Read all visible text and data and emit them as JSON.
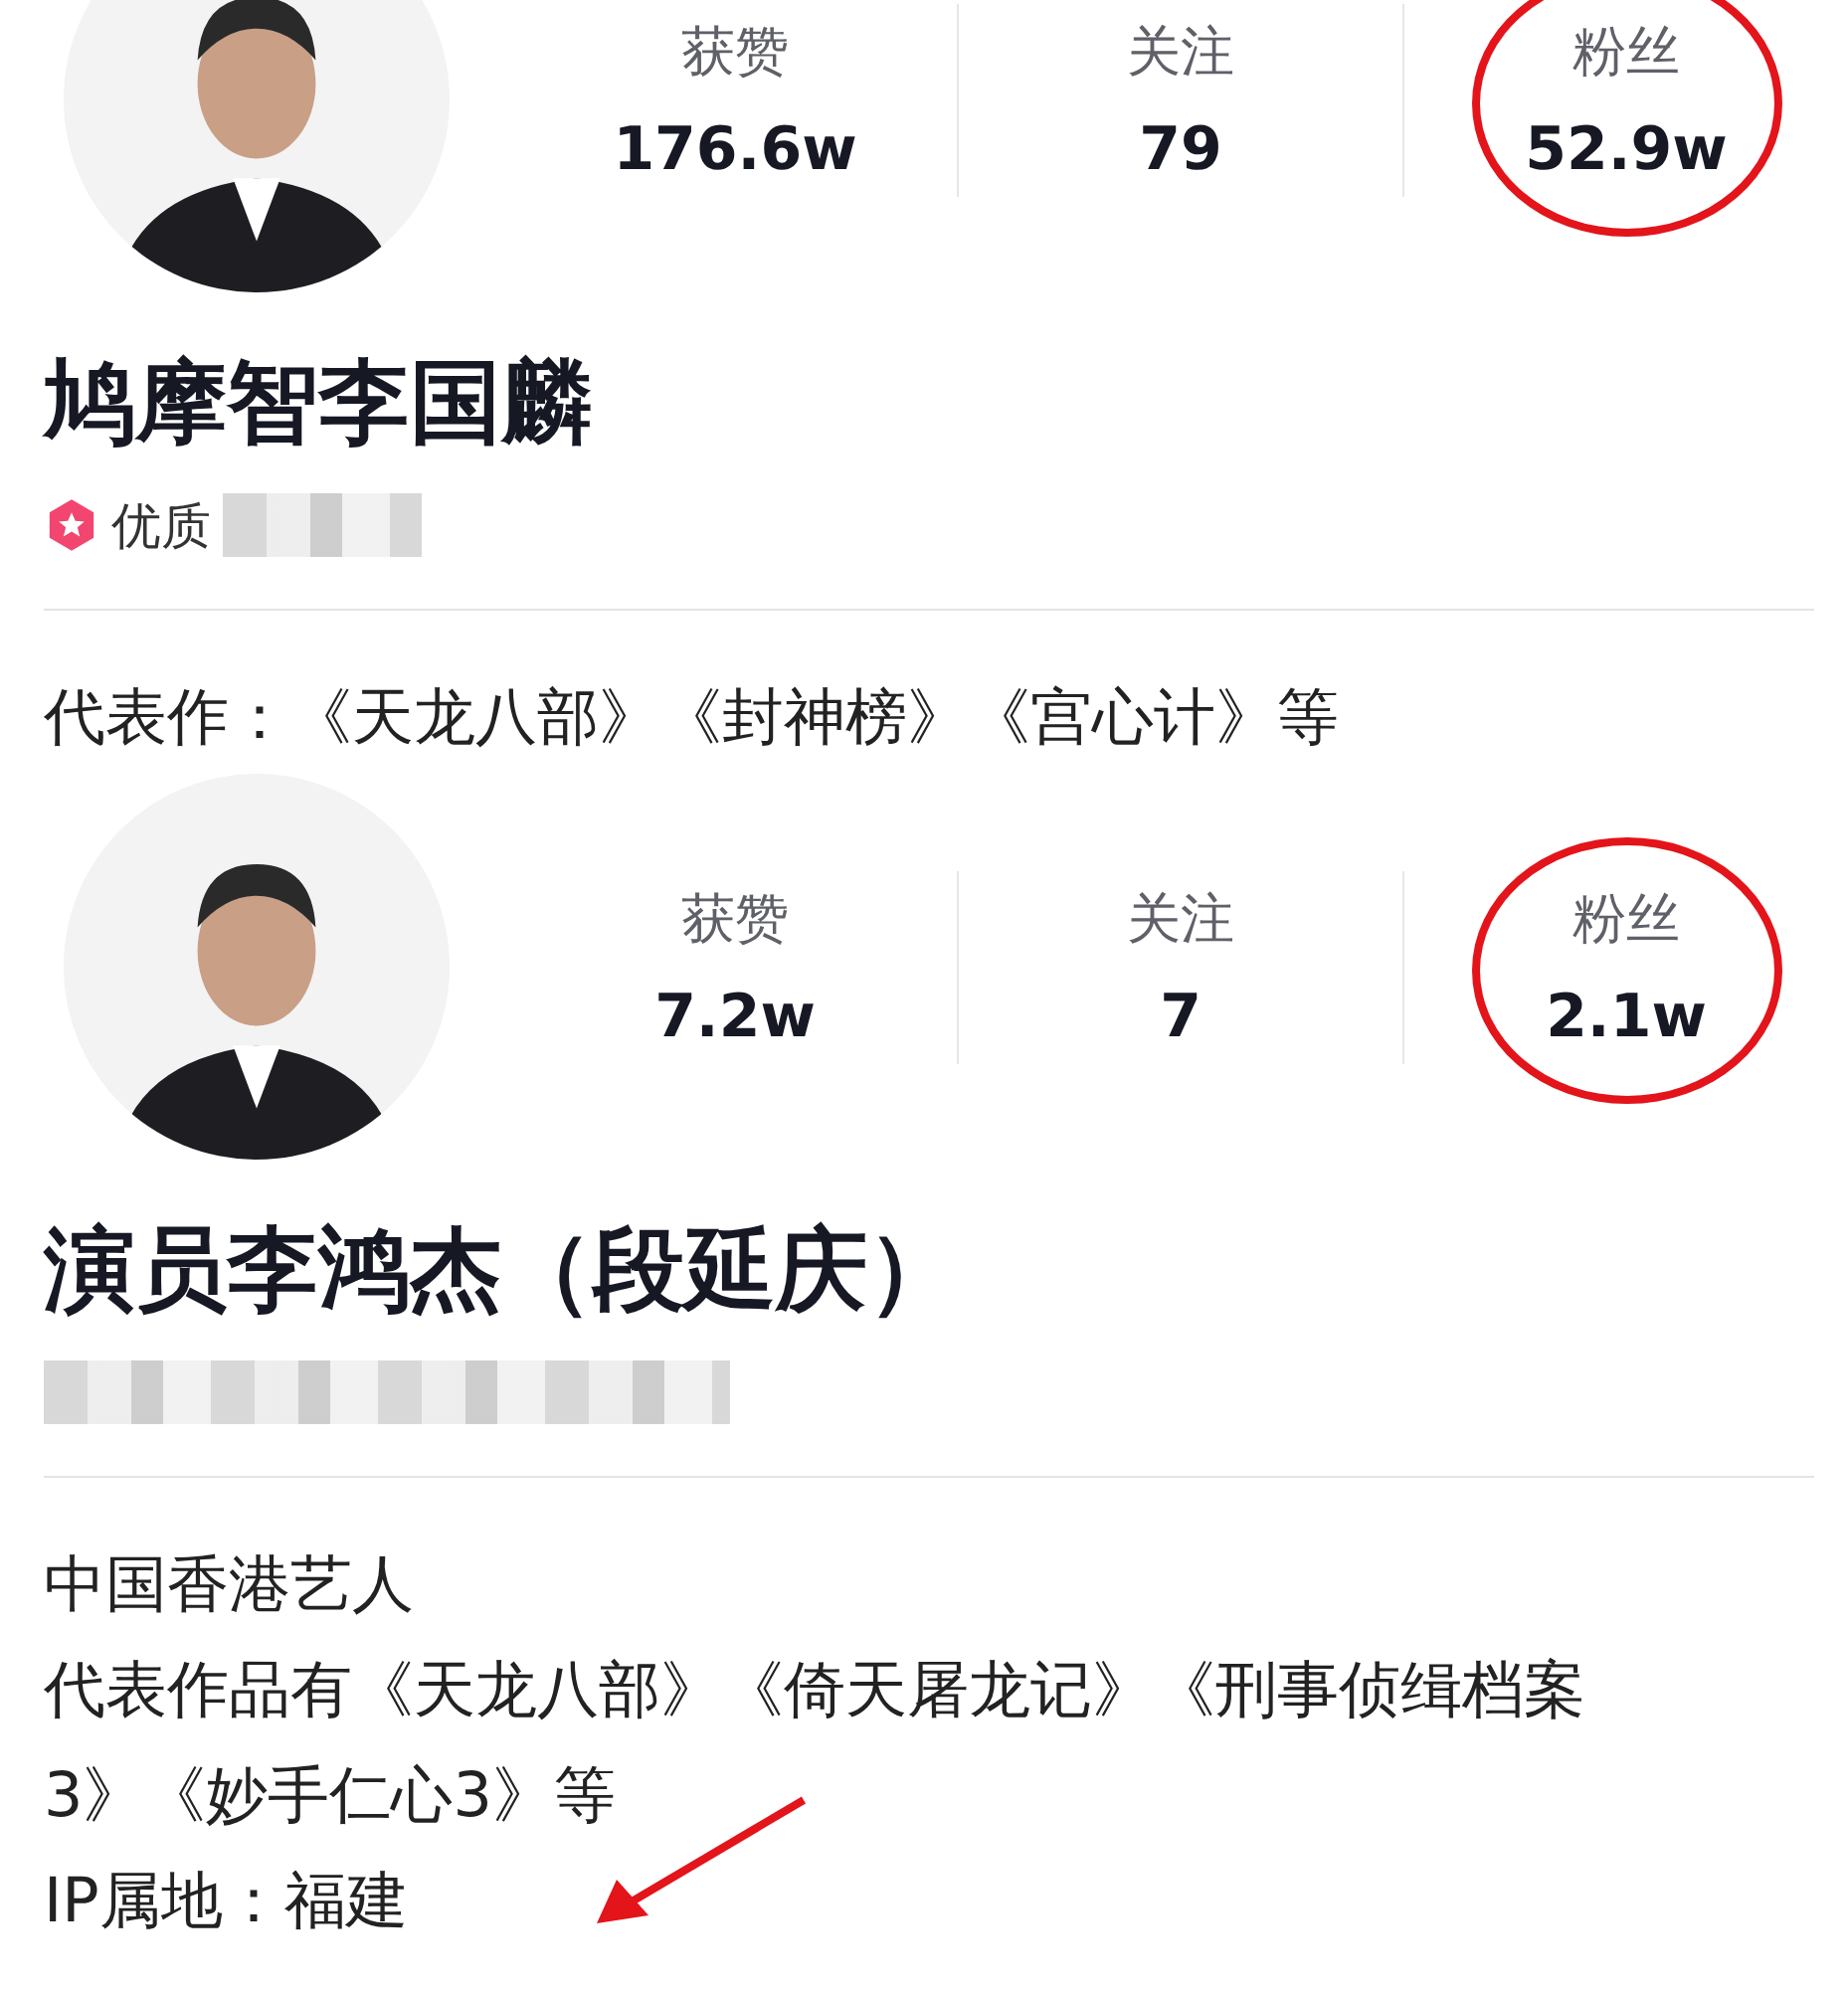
{
  "profiles": [
    {
      "stats": [
        {
          "label": "获赞",
          "value": "176.6w",
          "circled": false
        },
        {
          "label": "关注",
          "value": "79",
          "circled": false
        },
        {
          "label": "粉丝",
          "value": "52.9w",
          "circled": true
        }
      ],
      "name": "鸠摩智李国麟",
      "tag": {
        "label": "优质",
        "redacted": true
      },
      "bio_lines": [
        "代表作：《天龙八部》《封神榜》《宫心计》等"
      ],
      "pointer_arrow": false
    },
    {
      "stats": [
        {
          "label": "获赞",
          "value": "7.2w",
          "circled": false
        },
        {
          "label": "关注",
          "value": "7",
          "circled": false
        },
        {
          "label": "粉丝",
          "value": "2.1w",
          "circled": true
        }
      ],
      "name": "演员李鸿杰（段延庆）",
      "tag": {
        "redacted": true
      },
      "bio_lines": [
        "中国香港艺人",
        "代表作品有《天龙八部》《倚天屠龙记》《刑事侦缉档案",
        "3》《妙手仁心3》等",
        "IP属地：福建"
      ],
      "pointer_arrow": true
    }
  ]
}
